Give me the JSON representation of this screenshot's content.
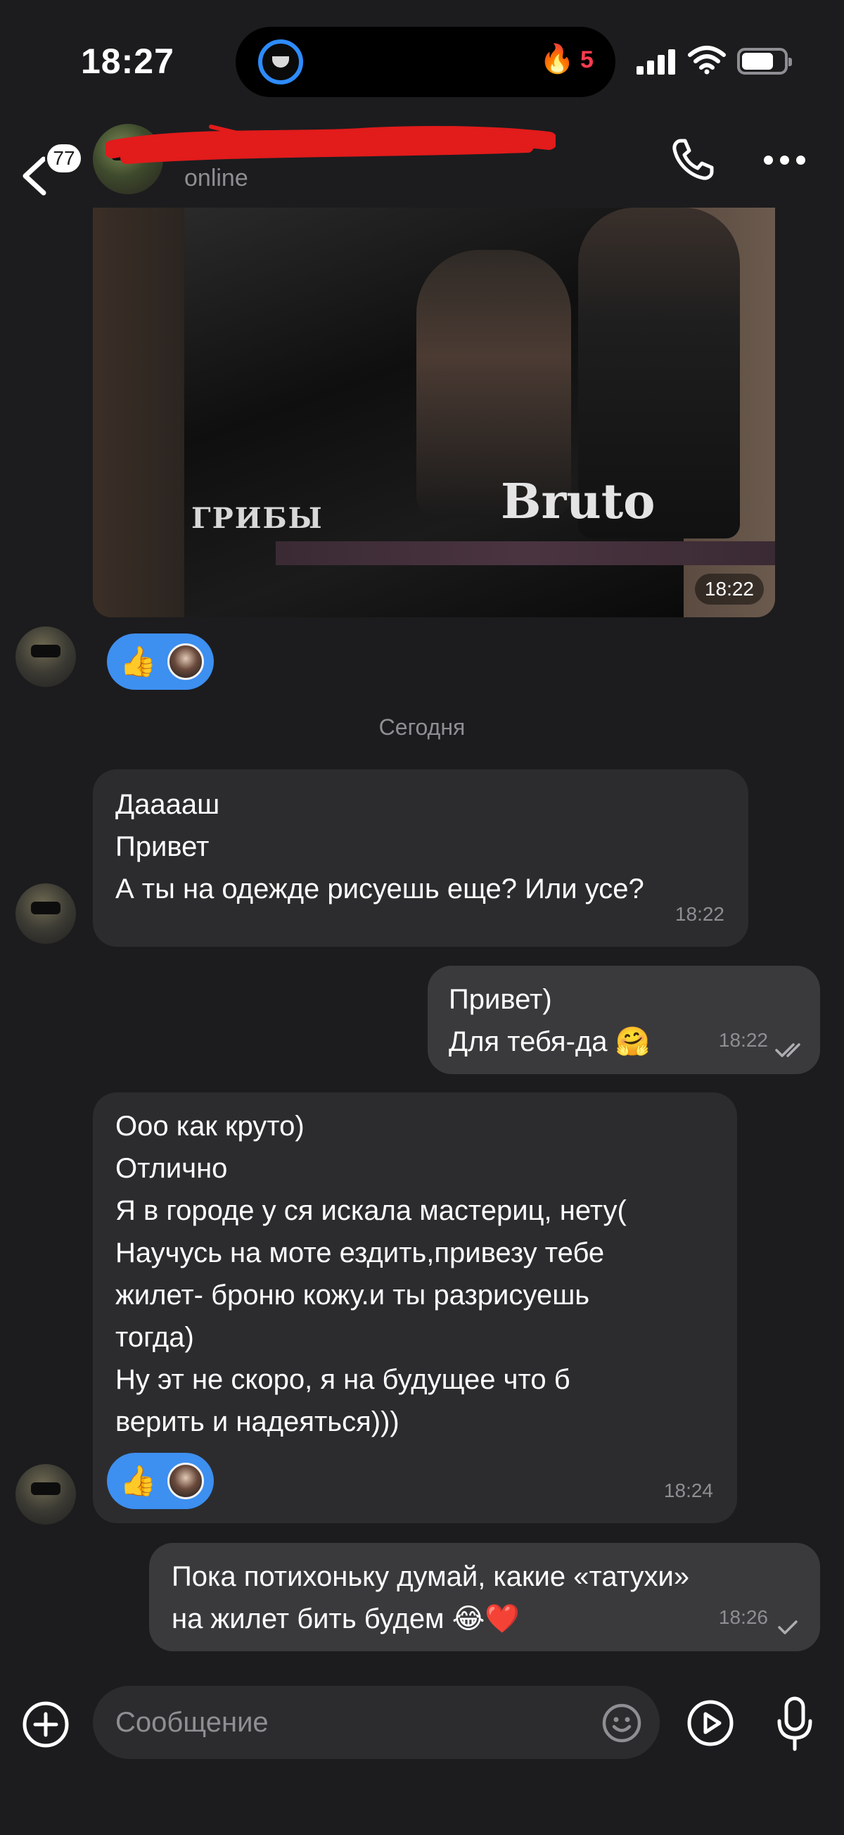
{
  "status_bar": {
    "time": "18:27",
    "streak_count": "5"
  },
  "header": {
    "unread_count": "77",
    "status": "online"
  },
  "photo_message": {
    "griby_text": "ГРИБЫ",
    "brand_text": "Bruto",
    "time": "18:22"
  },
  "date_separator": "Сегодня",
  "messages": [
    {
      "direction": "incoming",
      "text": "Дааааш\nПривет\nА ты на одежде рисуешь еще? Или усе?",
      "time": "18:22"
    },
    {
      "direction": "outgoing",
      "text": "Привет)\nДля тебя-да 🤗",
      "time": "18:22",
      "status": "read"
    },
    {
      "direction": "incoming",
      "text": "Ооо как круто)\nОтлично\nЯ в городе у ся искала мастериц, нету(\nНаучусь на моте ездить,привезу тебе\nжилет- броню кожу.и ты разрисуешь\nтогда)\nНу эт не скоро, я на будущее что б\nверить и надеяться)))",
      "time": "18:24",
      "reaction": "👍"
    },
    {
      "direction": "outgoing",
      "text": "Пока потихоньку думай, какие «татухи»\nна жилет бить будем 😂❤️",
      "time": "18:26",
      "status": "sent"
    }
  ],
  "photo_reaction": "👍",
  "composer": {
    "placeholder": "Сообщение"
  },
  "colors": {
    "background": "#1c1c1e",
    "incoming_bubble": "#2c2c2e",
    "outgoing_bubble": "#3a3a3c",
    "reaction_pill": "#3d8ff0",
    "streak": "#ff3b4e",
    "secondary_text": "#8e8e93"
  },
  "icons": [
    "back-chevron-icon",
    "phone-icon",
    "more-icon",
    "attach-plus-icon",
    "emoji-icon",
    "video-message-icon",
    "microphone-icon",
    "signal-icon",
    "wifi-icon",
    "battery-icon",
    "flame-icon"
  ]
}
